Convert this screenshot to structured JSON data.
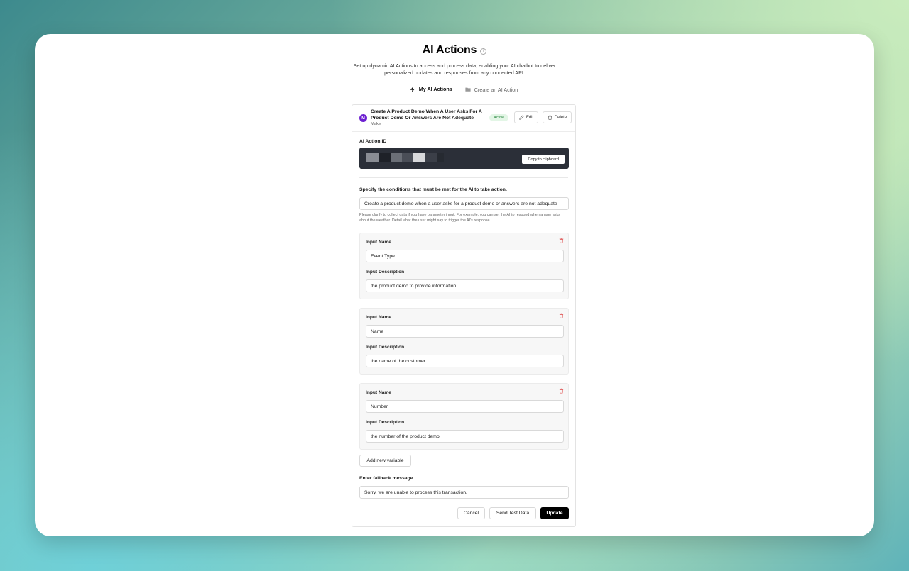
{
  "header": {
    "title": "AI Actions",
    "subtitle": "Set up dynamic AI Actions to access and process data, enabling your AI chatbot to deliver personalized updates and responses from any connected API."
  },
  "tabs": [
    {
      "label": "My AI Actions",
      "icon": "lightning-icon",
      "active": true
    },
    {
      "label": "Create an AI Action",
      "icon": "folder-icon",
      "active": false
    }
  ],
  "action": {
    "title": "Create A Product Demo When A User Asks For A Product Demo Or Answers Are Not Adequate",
    "provider": "Make",
    "logo_text": "M",
    "status": "Active",
    "edit_label": "Edit",
    "delete_label": "Delete"
  },
  "action_id": {
    "label": "AI Action ID",
    "copy_label": "Copy to clipboard"
  },
  "conditions": {
    "label": "Specify the conditions that must be met for the AI to take action.",
    "value": "Create a product demo when a user asks for a product demo or answers are not adequate",
    "help": "Please clarify to collect data if you have parameter input. For example, you can set the AI to respond when a user asks about the weather. Detail what the user might say to trigger the AI's response"
  },
  "variables": [
    {
      "name_label": "Input Name",
      "name_value": "Event Type",
      "desc_label": "Input Description",
      "desc_value": "the product demo to provide information"
    },
    {
      "name_label": "Input Name",
      "name_value": "Name",
      "desc_label": "Input Description",
      "desc_value": "the name of the customer"
    },
    {
      "name_label": "Input Name",
      "name_value": "Number",
      "desc_label": "Input Description",
      "desc_value": "the number of the product demo"
    }
  ],
  "add_variable_label": "Add new variable",
  "fallback": {
    "label": "Enter fallback message",
    "value": "Sorry, we are unable to process this transaction."
  },
  "footer": {
    "cancel_label": "Cancel",
    "test_label": "Send Test Data",
    "update_label": "Update"
  },
  "colors": {
    "accent": "#000000",
    "badge_bg": "#e3f6e6",
    "badge_text": "#2f8b45",
    "make_brand": "#6c1fd1",
    "delete_icon": "#e05a5a"
  }
}
